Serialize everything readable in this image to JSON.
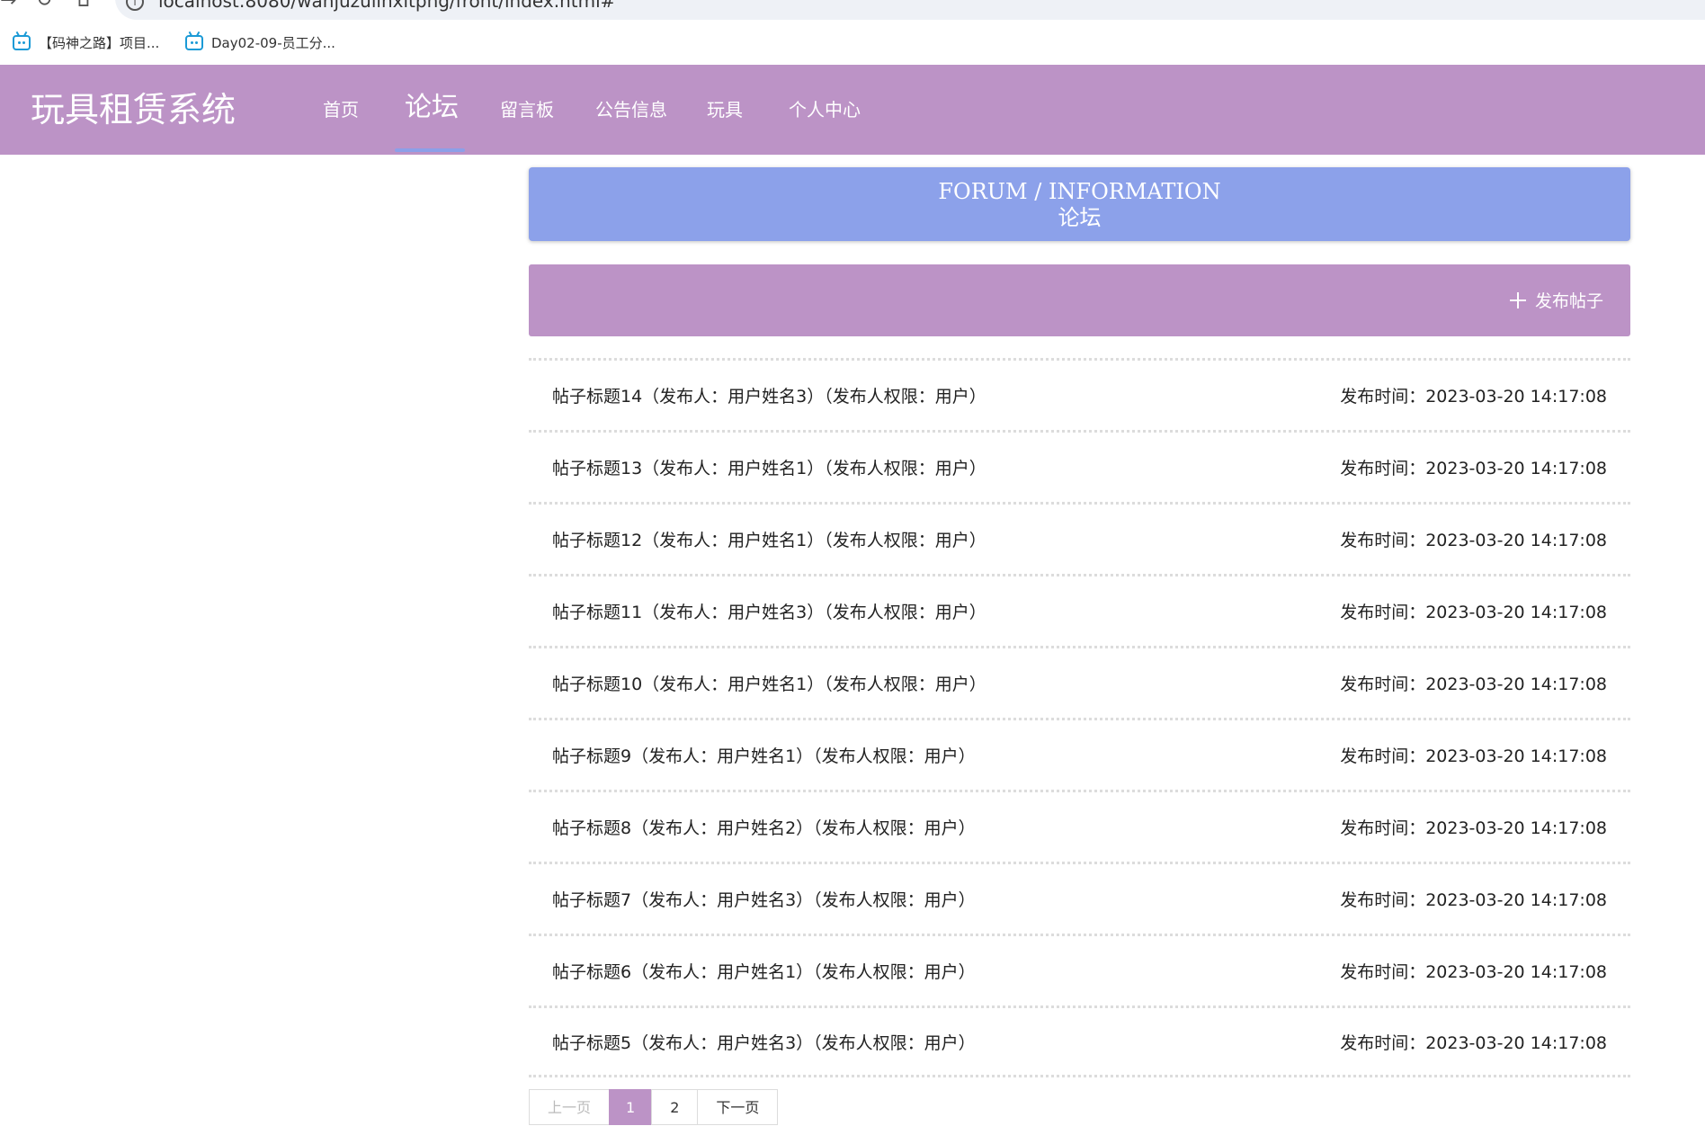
{
  "browser": {
    "url": "localhost:8080/wanjuzulinxitpng/front/index.html#",
    "bookmarks": [
      {
        "label": "【码神之路】项目..."
      },
      {
        "label": "Day02-09-员工分..."
      }
    ]
  },
  "header": {
    "site_title": "玩具租赁系统",
    "menu": [
      {
        "label": "首页"
      },
      {
        "label": "论坛"
      },
      {
        "label": "留言板"
      },
      {
        "label": "公告信息"
      },
      {
        "label": "玩具"
      },
      {
        "label": "个人中心"
      }
    ],
    "active_index": 1
  },
  "banner": {
    "title_en": "FORUM / INFORMATION",
    "title_cn": "论坛"
  },
  "actions": {
    "publish_label": "发布帖子"
  },
  "posts": [
    {
      "text": "帖子标题14（发布人：用户姓名3）（发布人权限：用户）",
      "time": "发布时间：2023-03-20 14:17:08"
    },
    {
      "text": "帖子标题13（发布人：用户姓名1）（发布人权限：用户）",
      "time": "发布时间：2023-03-20 14:17:08"
    },
    {
      "text": "帖子标题12（发布人：用户姓名1）（发布人权限：用户）",
      "time": "发布时间：2023-03-20 14:17:08"
    },
    {
      "text": "帖子标题11（发布人：用户姓名3）（发布人权限：用户）",
      "time": "发布时间：2023-03-20 14:17:08"
    },
    {
      "text": "帖子标题10（发布人：用户姓名1）（发布人权限：用户）",
      "time": "发布时间：2023-03-20 14:17:08"
    },
    {
      "text": "帖子标题9（发布人：用户姓名1）（发布人权限：用户）",
      "time": "发布时间：2023-03-20 14:17:08"
    },
    {
      "text": "帖子标题8（发布人：用户姓名2）（发布人权限：用户）",
      "time": "发布时间：2023-03-20 14:17:08"
    },
    {
      "text": "帖子标题7（发布人：用户姓名3）（发布人权限：用户）",
      "time": "发布时间：2023-03-20 14:17:08"
    },
    {
      "text": "帖子标题6（发布人：用户姓名1）（发布人权限：用户）",
      "time": "发布时间：2023-03-20 14:17:08"
    },
    {
      "text": "帖子标题5（发布人：用户姓名3）（发布人权限：用户）",
      "time": "发布时间：2023-03-20 14:17:08"
    }
  ],
  "pagination": {
    "prev_label": "上一页",
    "pages": [
      "1",
      "2"
    ],
    "current": "1",
    "next_label": "下一页"
  }
}
